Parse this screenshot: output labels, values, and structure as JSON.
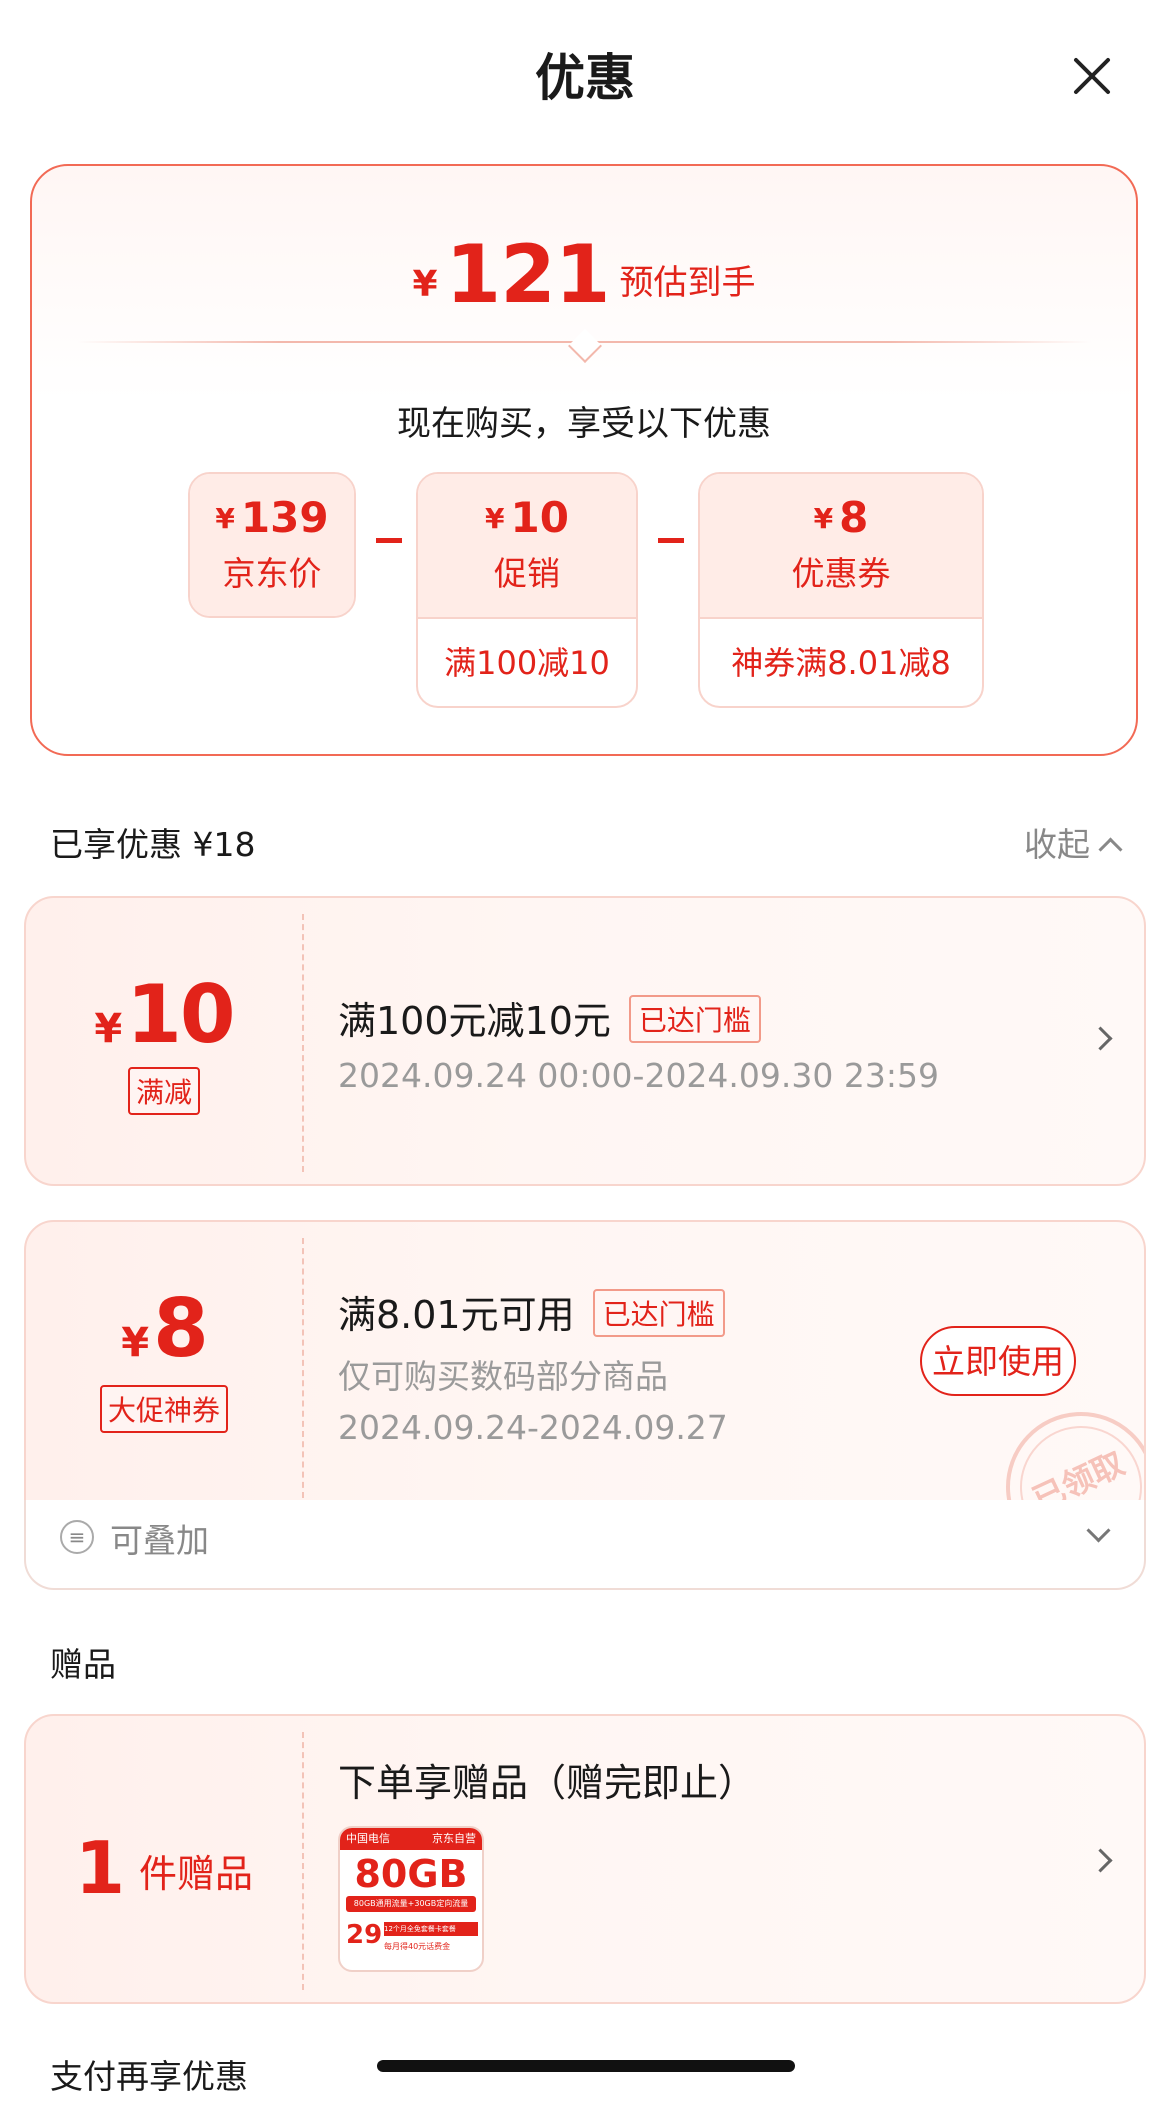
{
  "header": {
    "title": "优惠"
  },
  "summary": {
    "currency": "¥",
    "final_price": "121",
    "final_label": "预估到手",
    "subtitle": "现在购买，享受以下优惠",
    "items": [
      {
        "amount": "139",
        "name": "京东价",
        "detail": ""
      },
      {
        "amount": "10",
        "name": "促销",
        "detail": "满100减10"
      },
      {
        "amount": "8",
        "name": "优惠券",
        "detail": "神券满8.01减8"
      }
    ],
    "operator": "-"
  },
  "enjoyed": {
    "title": "已享优惠 ¥18",
    "collapse_label": "收起"
  },
  "coupons": [
    {
      "currency": "¥",
      "amount": "10",
      "tag": "满减",
      "title": "满100元减10元",
      "badge": "已达门槛",
      "lines": [
        "2024.09.24 00:00-2024.09.30 23:59"
      ]
    },
    {
      "currency": "¥",
      "amount": "8",
      "tag": "大促神券",
      "title": "满8.01元可用",
      "badge": "已达门槛",
      "lines": [
        "仅可购买数码部分商品",
        "2024.09.24-2024.09.27"
      ],
      "action": "立即使用",
      "stamp": "已领取",
      "stack_label": "可叠加"
    }
  ],
  "gifts": {
    "title": "赠品",
    "count": "1",
    "count_label": "件赠品",
    "desc": "下单享赠品（赠完即止）",
    "product": {
      "brand": "中国电信",
      "seller": "京东自营",
      "headline": "80GB",
      "price": "29",
      "line1": "80GB通用流量+30GB定向流量",
      "line2": "12个月全免套餐卡套餐",
      "line3": "每月得40元话费金"
    }
  },
  "pay": {
    "title": "支付再享优惠"
  },
  "colors": {
    "accent": "#e2231a",
    "border": "#f26a55",
    "light_bg": "#ffece7"
  },
  "icons": {
    "close": "close-icon",
    "collapse": "chevron-up-icon",
    "arrow": "chevron-right-icon",
    "stack": "stack-icon",
    "expand": "chevron-down-icon"
  }
}
